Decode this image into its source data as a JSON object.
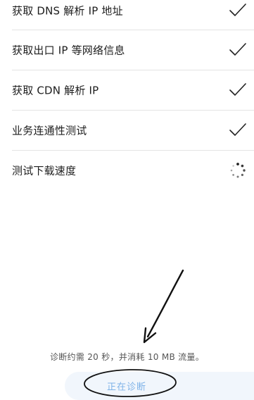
{
  "checklist": [
    {
      "label": "获取 DNS 解析 IP 地址",
      "status": "done",
      "status_icon": "checkmark-icon"
    },
    {
      "label": "获取出口 IP 等网络信息",
      "status": "done",
      "status_icon": "checkmark-icon"
    },
    {
      "label": "获取 CDN 解析 IP",
      "status": "done",
      "status_icon": "checkmark-icon"
    },
    {
      "label": "业务连通性测试",
      "status": "done",
      "status_icon": "checkmark-icon"
    },
    {
      "label": "测试下载速度",
      "status": "in-progress",
      "status_icon": "loading-spinner-icon"
    }
  ],
  "footer": {
    "note": "诊断约需 20 秒，并消耗 10 MB 流量。"
  },
  "action_button": {
    "label": "正在诊断",
    "text_color": "#7fb3e8",
    "background": "#f1f6fc"
  },
  "annotations": {
    "arrow_icon": "hand-drawn-arrow-icon",
    "ellipse_icon": "hand-drawn-circle-icon"
  },
  "colors": {
    "divider": "#e4e4e4",
    "text": "#1e1e1e",
    "check": "#222222"
  }
}
